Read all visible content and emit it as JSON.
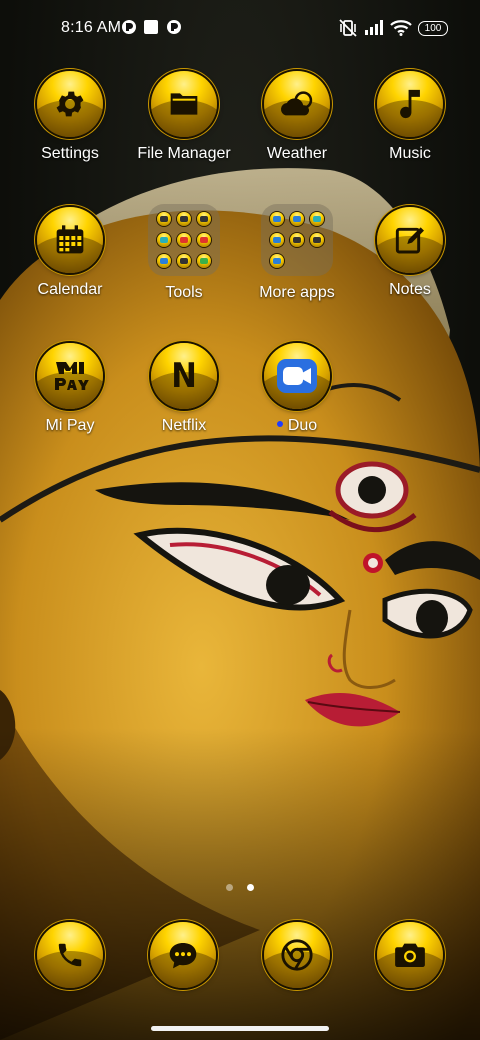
{
  "status_bar": {
    "time": "8:16 AM",
    "battery": "100",
    "icons": [
      "notification-icon",
      "square-notification-icon",
      "notification-icon",
      "vibrate-mute-icon",
      "signal-icon",
      "wifi-icon",
      "battery-icon"
    ]
  },
  "apps": {
    "settings": "Settings",
    "file_manager": "File Manager",
    "weather": "Weather",
    "music": "Music",
    "calendar": "Calendar",
    "tools": "Tools",
    "more_apps": "More apps",
    "notes": "Notes",
    "mi_pay": "Mi Pay",
    "netflix": "Netflix",
    "duo": "Duo"
  },
  "icon_text": {
    "netflix_glyph": "N"
  },
  "page_indicator": {
    "pages": 2,
    "current": 2
  },
  "dock": [
    "phone-icon",
    "messages-icon",
    "chrome-icon",
    "camera-icon"
  ],
  "colors": {
    "icon_gold": "#ffd400",
    "icon_dark": "#1a1200",
    "duo_dot": "#1d3cff",
    "text": "#ffffff"
  }
}
